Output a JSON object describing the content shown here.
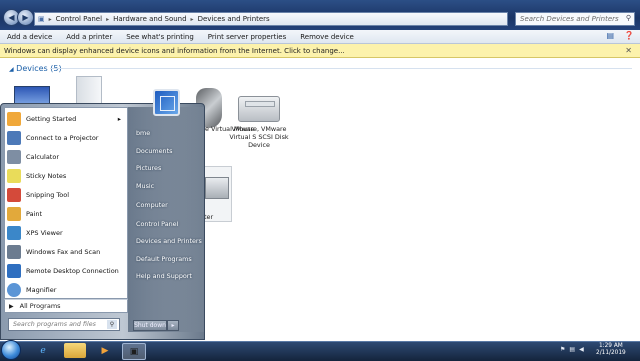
{
  "address_bar": {
    "crumbs": [
      "Control Panel",
      "Hardware and Sound",
      "Devices and Printers"
    ],
    "search_placeholder": "Search Devices and Printers"
  },
  "command_bar": {
    "items": [
      "Add a device",
      "Add a printer",
      "See what's printing",
      "Print server properties",
      "Remove device"
    ]
  },
  "info_bar": {
    "message": "Windows can display enhanced device icons and information from the Internet. Click to change..."
  },
  "devices": {
    "header": "Devices (5)",
    "items": [
      {
        "label": "VMware, VMware Virtual S SCSI Disk Device"
      },
      {
        "label": "ware Virtual Mouse"
      },
      {
        "label": "nter"
      }
    ]
  },
  "start_menu": {
    "programs": [
      {
        "label": "Getting Started",
        "has_arrow": true,
        "icon": "getting-started-icon",
        "color": "#f0a83a"
      },
      {
        "label": "Connect to a Projector",
        "has_arrow": false,
        "icon": "projector-icon",
        "color": "#4c79b8"
      },
      {
        "label": "Calculator",
        "has_arrow": false,
        "icon": "calculator-icon",
        "color": "#7e8ea3"
      },
      {
        "label": "Sticky Notes",
        "has_arrow": false,
        "icon": "sticky-notes-icon",
        "color": "#e9dc5a"
      },
      {
        "label": "Snipping Tool",
        "has_arrow": false,
        "icon": "scissors-icon",
        "color": "#d44a3a"
      },
      {
        "label": "Paint",
        "has_arrow": false,
        "icon": "paint-icon",
        "color": "#e2a93b"
      },
      {
        "label": "XPS Viewer",
        "has_arrow": false,
        "icon": "xps-viewer-icon",
        "color": "#3b87c9"
      },
      {
        "label": "Windows Fax and Scan",
        "has_arrow": false,
        "icon": "fax-icon",
        "color": "#6c7c90"
      },
      {
        "label": "Remote Desktop Connection",
        "has_arrow": false,
        "icon": "remote-desktop-icon",
        "color": "#2f6fc0"
      },
      {
        "label": "Magnifier",
        "has_arrow": false,
        "icon": "magnifier-icon",
        "color": "#5b95d6"
      }
    ],
    "all_programs": "All Programs",
    "search_placeholder": "Search programs and files",
    "right_links": [
      "bme",
      "Documents",
      "Pictures",
      "Music",
      "Computer",
      "Control Panel",
      "Devices and Printers",
      "Default Programs",
      "Help and Support"
    ],
    "shutdown_label": "Shut down"
  },
  "taskbar": {
    "time": "1:29 AM",
    "date": "2/11/2019"
  }
}
